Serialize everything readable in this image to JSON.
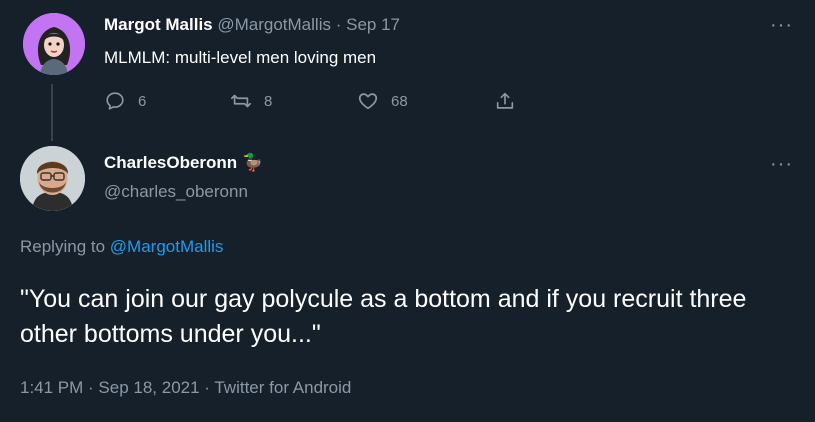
{
  "original_tweet": {
    "display_name": "Margot Mallis",
    "handle": "@MargotMallis",
    "separator": "·",
    "date": "Sep 17",
    "text": "MLMLM: multi-level men loving men",
    "actions": {
      "replies": "6",
      "retweets": "8",
      "likes": "68"
    }
  },
  "reply_tweet": {
    "display_name": "CharlesOberonn",
    "name_emoji": "🦆",
    "handle": "@charles_oberonn",
    "replying_prefix": "Replying to",
    "replying_to": "@MargotMallis",
    "text": "\"You can join our gay polycule as a bottom and if you recruit three other bottoms under you...\"",
    "meta": "1:41 PM · Sep 18, 2021 · Twitter for Android"
  },
  "icons": {
    "more": "more-horizontal-icon",
    "reply": "reply-icon",
    "retweet": "retweet-icon",
    "like": "heart-icon",
    "share": "share-icon"
  },
  "colors": {
    "background": "#15202b",
    "text": "#ffffff",
    "muted": "#8b98a5",
    "link": "#1d9bf0",
    "thread_line": "#38444d"
  }
}
